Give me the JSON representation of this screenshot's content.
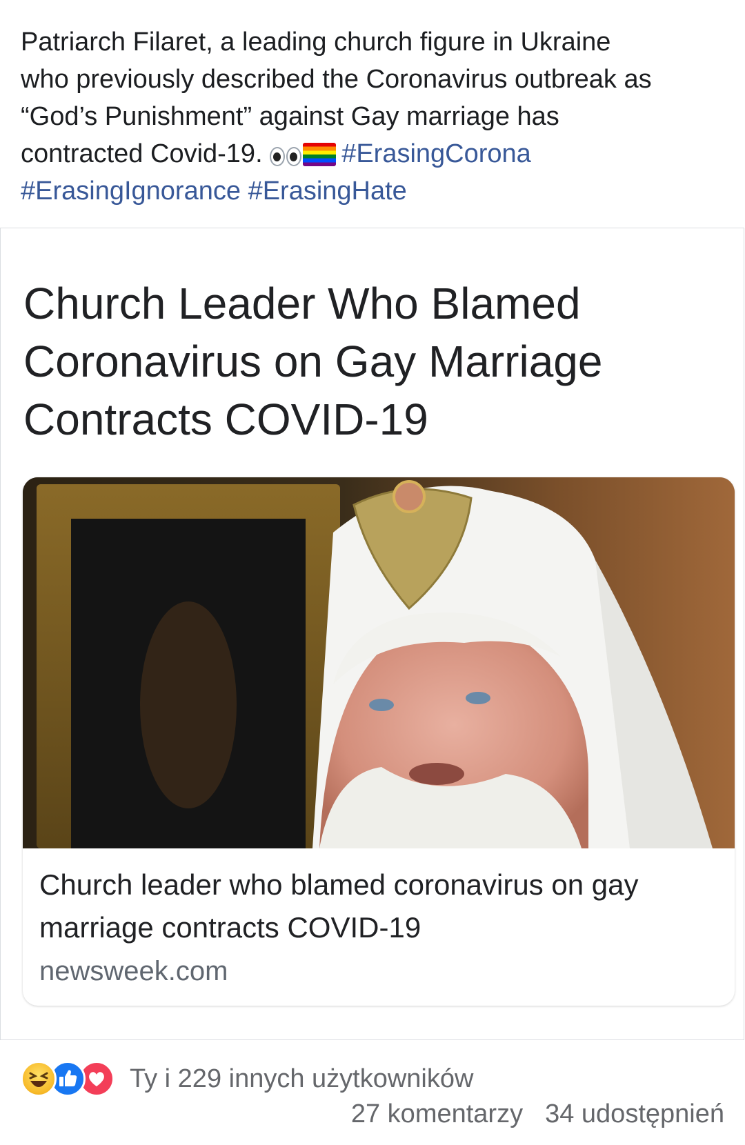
{
  "post": {
    "text_lines": [
      "Patriarch Filaret, a leading church figure in Ukraine",
      "who previously described the Coronavirus outbreak as",
      "“God’s Punishment” against Gay marriage has",
      "contracted Covid-19."
    ],
    "emojis": [
      "eyes-emoji",
      "rainbow-flag-emoji"
    ],
    "hashtags": [
      "#ErasingCorona",
      "#ErasingIgnorance",
      "#ErasingHate"
    ]
  },
  "shared_image": {
    "headline": "Church Leader Who Blamed Coronavirus on Gay Marriage Contracts COVID-19",
    "link_title": "Church leader who blamed coronavirus on gay marriage contracts COVID-19",
    "link_domain": "newsweek.com"
  },
  "reactions": {
    "icons": [
      "haha-reaction-icon",
      "like-reaction-icon",
      "love-reaction-icon"
    ],
    "summary": "Ty i 229 innych użytkowników",
    "comments": "27 komentarzy",
    "shares": "34 udostępnień"
  },
  "colors": {
    "hashtag": "#385898",
    "like": "#1877f2",
    "love": "#f33e58",
    "haha": "#f7b928",
    "muted_text": "#65676b"
  }
}
